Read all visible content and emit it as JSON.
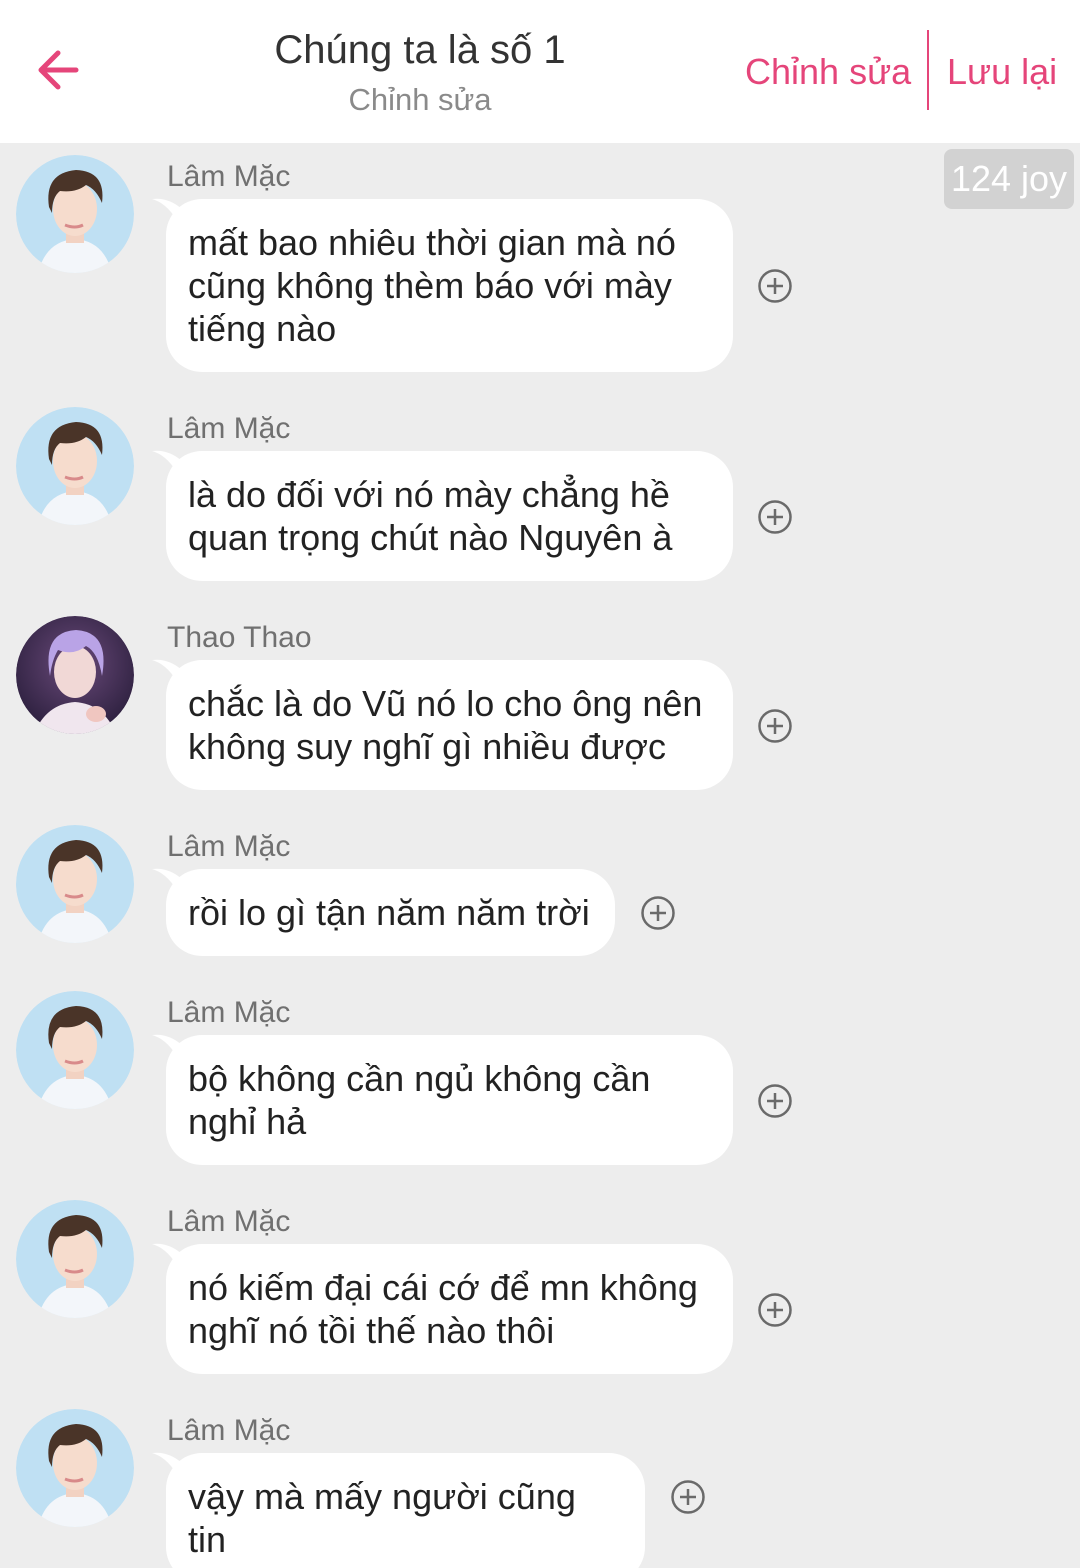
{
  "header": {
    "title": "Chúng ta là số 1",
    "subtitle": "Chỉnh sửa",
    "edit_label": "Chỉnh sửa",
    "save_label": "Lưu lại",
    "accent_color": "#e5457a"
  },
  "joy_badge": "124 joy",
  "messages": [
    {
      "sender": "Lâm Mặc",
      "avatar": "lam-mac",
      "text": "mất bao nhiêu thời gian mà nó cũng không thèm báo với mày tiếng nào"
    },
    {
      "sender": "Lâm Mặc",
      "avatar": "lam-mac",
      "text": "là do đối với nó mày chẳng hề quan trọng chút nào Nguyên à"
    },
    {
      "sender": "Thao Thao",
      "avatar": "thao-thao",
      "text": "chắc là do Vũ nó lo cho ông nên không suy nghĩ gì nhiều được"
    },
    {
      "sender": "Lâm Mặc",
      "avatar": "lam-mac",
      "text": "rồi lo gì tận năm năm trời"
    },
    {
      "sender": "Lâm Mặc",
      "avatar": "lam-mac",
      "text": "bộ không cần ngủ không cần nghỉ hả"
    },
    {
      "sender": "Lâm Mặc",
      "avatar": "lam-mac",
      "text": "nó kiếm đại cái cớ để mn không nghĩ nó tồi thế nào thôi"
    },
    {
      "sender": "Lâm Mặc",
      "avatar": "lam-mac",
      "text": "vậy mà mấy người cũng tin"
    }
  ]
}
